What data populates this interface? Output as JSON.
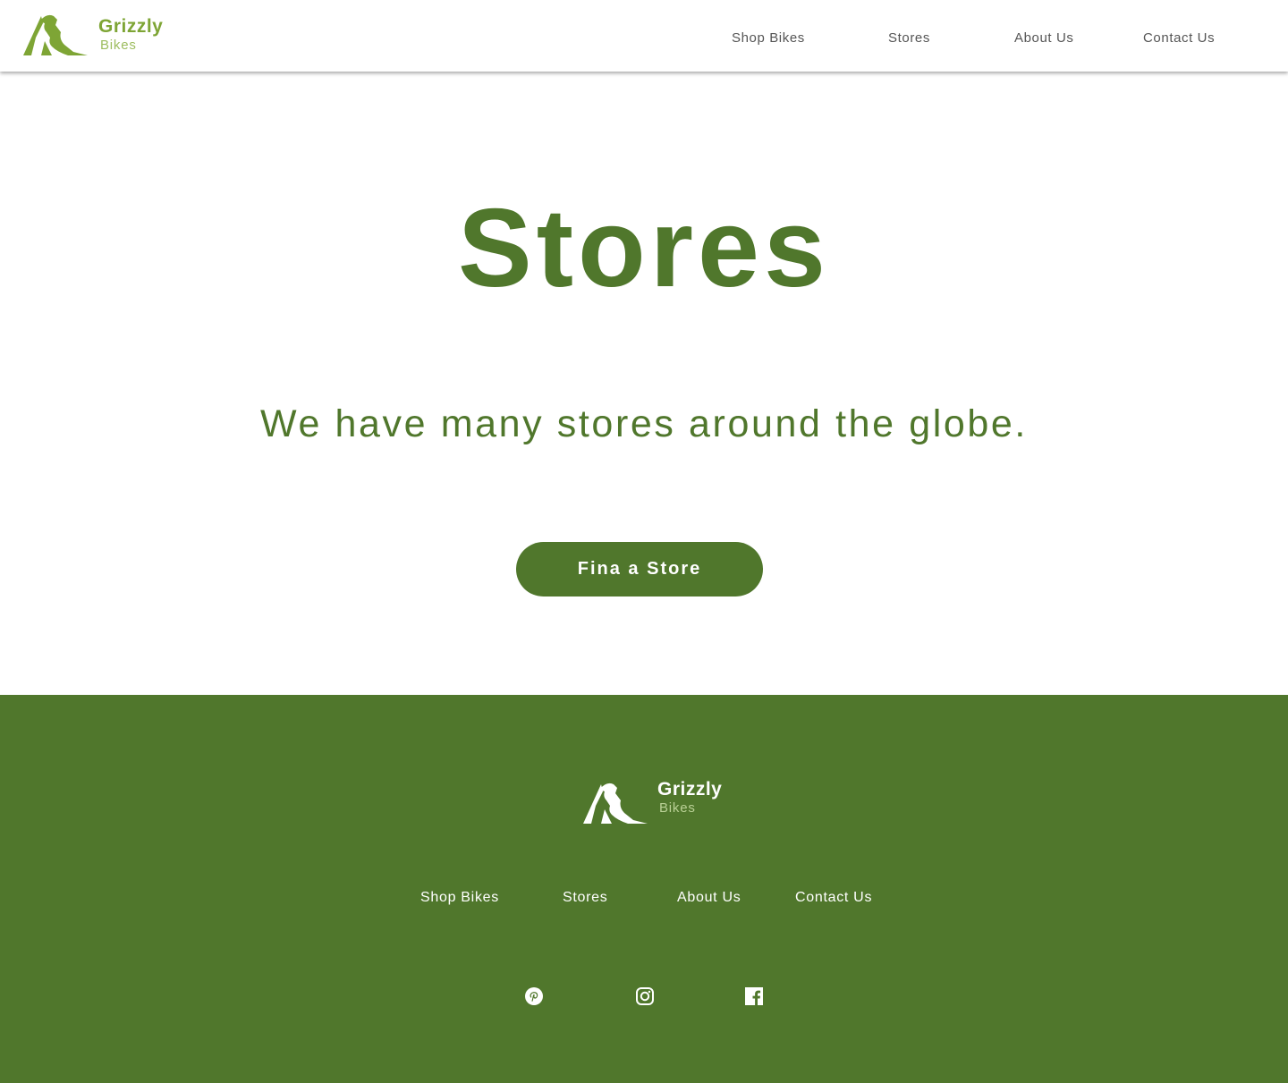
{
  "brand": {
    "name": "Grizzly",
    "sub": "Bikes"
  },
  "nav": {
    "shop_bikes": "Shop Bikes",
    "stores": "Stores",
    "about_us": "About Us",
    "contact_us": "Contact Us"
  },
  "hero": {
    "title": "Stores",
    "subtitle": "We have many stores around the globe.",
    "cta_label": "Fina a Store"
  },
  "footer": {
    "brand_name": "Grizzly",
    "brand_sub": "Bikes",
    "links": {
      "shop_bikes": "Shop Bikes",
      "stores": "Stores",
      "about_us": "About Us",
      "contact_us": "Contact Us"
    },
    "social": [
      "pinterest-icon",
      "instagram-icon",
      "facebook-icon"
    ]
  },
  "colors": {
    "primary_green": "#50772c",
    "logo_green": "#7ea535",
    "logo_light_green": "#9dbd5f",
    "nav_text": "#555555"
  }
}
